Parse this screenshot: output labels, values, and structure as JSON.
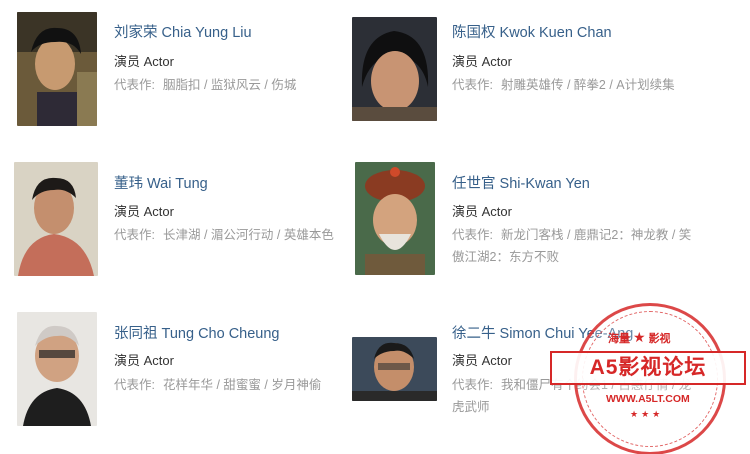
{
  "cast": [
    {
      "name": "刘家荣 Chia Yung Liu",
      "role": "演员 Actor",
      "works_label": "代表作:",
      "works": "胭脂扣 / 监狱风云 / 伤城"
    },
    {
      "name": "陈国权 Kwok Kuen Chan",
      "role": "演员 Actor",
      "works_label": "代表作:",
      "works": "射雕英雄传 / 醉拳2 / A计划续集"
    },
    {
      "name": "董玮 Wai Tung",
      "role": "演员 Actor",
      "works_label": "代表作:",
      "works": "长津湖 / 湄公河行动 / 英雄本色"
    },
    {
      "name": "任世官 Shi-Kwan Yen",
      "role": "演员 Actor",
      "works_label": "代表作:",
      "works": "新龙门客栈 / 鹿鼎记2：神龙教 / 笑傲江湖2：东方不败"
    },
    {
      "name": "张同祖 Tung Cho Cheung",
      "role": "演员 Actor",
      "works_label": "代表作:",
      "works": "花样年华 / 甜蜜蜜 / 岁月神偷"
    },
    {
      "name": "徐二牛 Simon Chui Yee-Ang",
      "role": "演员 Actor",
      "works_label": "代表作:",
      "works": "我和僵尸有个约会1 / 古惑仔情 / 龙虎武师"
    }
  ],
  "watermark": {
    "top_left": "海量",
    "top_right": "影视",
    "title": "A5影视论坛",
    "url": "WWW.A5LT.COM",
    "colors": {
      "stamp": "#d62828"
    }
  },
  "colors": {
    "name_link": "#37608a",
    "role": "#333333",
    "works": "#999999"
  }
}
